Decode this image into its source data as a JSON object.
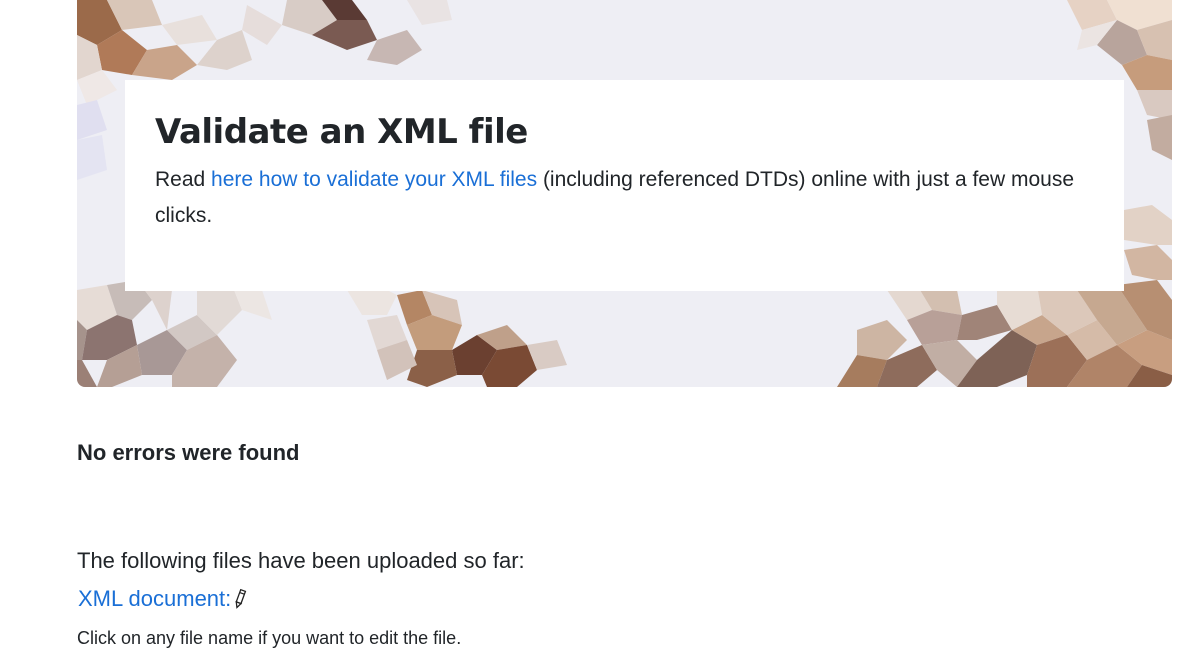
{
  "hero": {
    "title": "Validate an XML file",
    "text_before": "Read ",
    "link_text": "here how to validate your XML files",
    "text_after": " (including referenced DTDs) online with just a few mouse clicks."
  },
  "result": {
    "status": "No errors were found"
  },
  "files": {
    "intro": "The following files have been uploaded so far:",
    "items": [
      {
        "label": "XML document:",
        "icon": "pencil-icon"
      }
    ],
    "hint": "Click on any file name if you want to edit the file."
  },
  "colors": {
    "link": "#1a6fd6",
    "text": "#212529",
    "hero_background": "#eeeef4"
  }
}
